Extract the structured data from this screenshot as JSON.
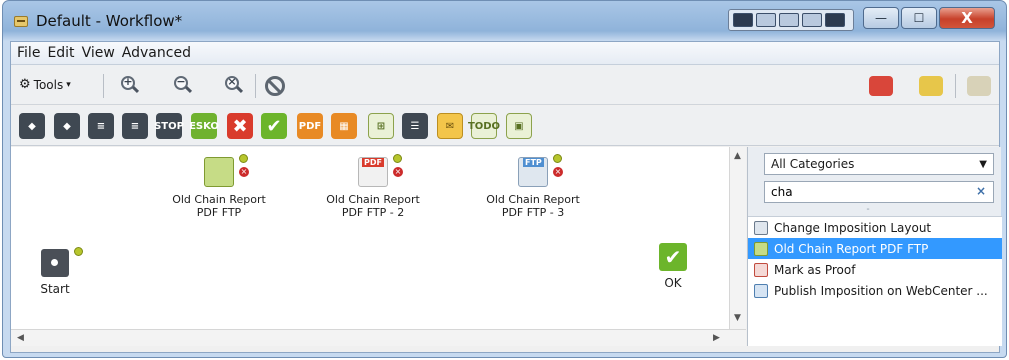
{
  "window": {
    "title": "Default - Workflow*",
    "controls": {
      "minimize": "—",
      "maximize": "☐",
      "close": "X"
    }
  },
  "menu": [
    "File",
    "Edit",
    "View",
    "Advanced"
  ],
  "toolbar": {
    "tools_label": "Tools",
    "tools_caret": "▾",
    "zoom_in": "+",
    "zoom_out": "−",
    "zoom_fit": "×"
  },
  "palette": {
    "stop_label": "STOP",
    "esko_label": "ESKO",
    "pdf_label": "PDF",
    "todo_label": "TODO"
  },
  "canvas": {
    "nodes": [
      {
        "label_line1": "Old Chain Report",
        "label_line2": "PDF FTP",
        "badge": "",
        "error_symbol": "×"
      },
      {
        "label_line1": "Old Chain Report",
        "label_line2": "PDF FTP - 2",
        "badge": "PDF",
        "error_symbol": "×"
      },
      {
        "label_line1": "Old Chain Report",
        "label_line2": "PDF FTP - 3",
        "badge": "FTP",
        "error_symbol": "×"
      }
    ],
    "start_label": "Start",
    "ok_label": "OK",
    "ok_symbol": "✔"
  },
  "sidebar": {
    "category": "All Categories",
    "category_caret": "▼",
    "search_value": "cha",
    "search_clear": "×",
    "grip": "⁃",
    "items": [
      {
        "label": "Change Imposition Layout",
        "selected": false
      },
      {
        "label": "Old Chain Report PDF FTP",
        "selected": true
      },
      {
        "label": "Mark as Proof",
        "selected": false
      },
      {
        "label": "Publish Imposition on WebCenter ...",
        "selected": false
      }
    ]
  },
  "scroll": {
    "up": "▲",
    "down": "▼",
    "left": "◀",
    "right": "▶"
  },
  "colors": {
    "selection": "#3399ff",
    "ok_green": "#6cb52b",
    "error_red": "#cc2b2b"
  }
}
